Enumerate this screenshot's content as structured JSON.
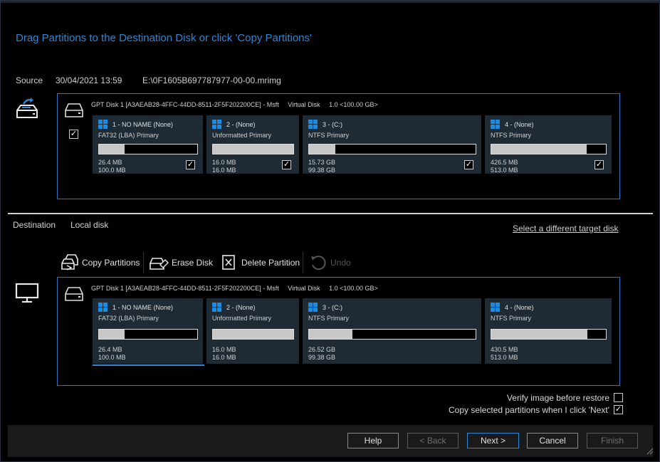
{
  "heading": "Drag Partitions to the Destination Disk or click 'Copy Partitions'",
  "source": {
    "label": "Source",
    "date": "30/04/2021 13:59",
    "path": "E:\\0F1605B697787977-00-00.mrimg",
    "disk": {
      "name": "GPT Disk 1 [A3AEAB28-4FFC-44DD-8511-2F5F202200CE] - Msft",
      "kind": "Virtual Disk",
      "size": "1.0  <100.00 GB>",
      "checked": true
    },
    "partitions": [
      {
        "name": "1 - NO NAME (None)",
        "type": "FAT32 (LBA) Primary",
        "used": "26.4 MB",
        "total": "100.0 MB",
        "fill": 0.26,
        "checked": true
      },
      {
        "name": "2 - (None)",
        "type": "Unformatted Primary",
        "used": "16.0 MB",
        "total": "16.0 MB",
        "fill": 1.0,
        "checked": true
      },
      {
        "name": "3 - (C:)",
        "type": "NTFS Primary",
        "used": "15.73 GB",
        "total": "99.38 GB",
        "fill": 0.16,
        "checked": true
      },
      {
        "name": "4 - (None)",
        "type": "NTFS Primary",
        "used": "426.5 MB",
        "total": "513.0 MB",
        "fill": 0.83,
        "checked": true
      }
    ]
  },
  "destination": {
    "label": "Destination",
    "type": "Local disk",
    "select_target": "Select a different target disk",
    "toolbar": {
      "copy": "Copy Partitions",
      "erase": "Erase Disk",
      "delete": "Delete Partition",
      "undo": "Undo"
    },
    "disk": {
      "name": "GPT Disk 1 [A3AEAB28-4FFC-44DD-8511-2F5F202200CE] - Msft",
      "kind": "Virtual Disk",
      "size": "1.0  <100.00 GB>"
    },
    "partitions": [
      {
        "name": "1 - NO NAME (None)",
        "type": "FAT32 (LBA) Primary",
        "used": "26.4 MB",
        "total": "100.0 MB",
        "fill": 0.26
      },
      {
        "name": "2 - (None)",
        "type": "Unformatted Primary",
        "used": "16.0 MB",
        "total": "16.0 MB",
        "fill": 1.0
      },
      {
        "name": "3 - (C:)",
        "type": "NTFS Primary",
        "used": "26.52 GB",
        "total": "99.38 GB",
        "fill": 0.26
      },
      {
        "name": "4 - (None)",
        "type": "NTFS Primary",
        "used": "430.5 MB",
        "total": "513.0 MB",
        "fill": 0.84
      }
    ]
  },
  "options": {
    "verify": {
      "label": "Verify image before restore",
      "checked": false
    },
    "copy_selected": {
      "label": "Copy selected partitions when I click 'Next'",
      "checked": true
    }
  },
  "buttons": {
    "help": "Help",
    "back": "< Back",
    "next": "Next >",
    "cancel": "Cancel",
    "finish": "Finish"
  },
  "colors": {
    "accent": "#2f86d4",
    "partition_bg": "#1e2b34",
    "windows_blue": "#1c8ce0"
  }
}
